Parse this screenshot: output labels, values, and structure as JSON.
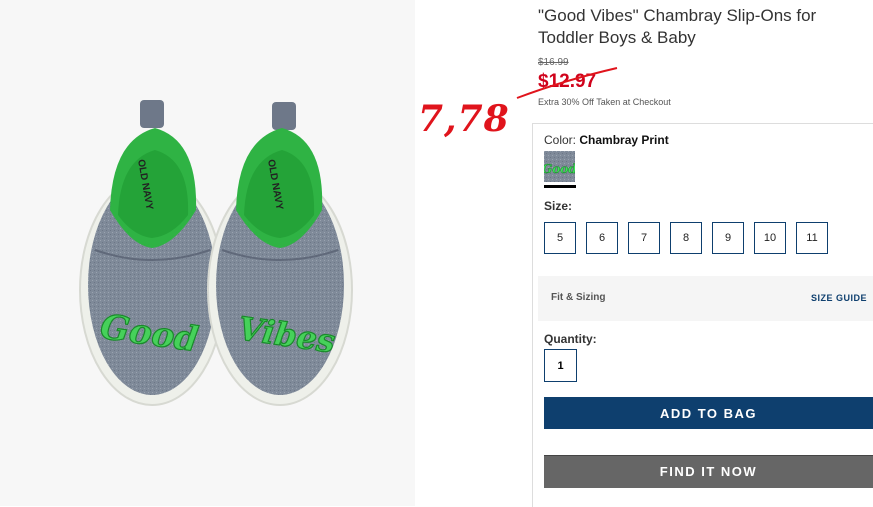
{
  "product": {
    "title": "\"Good Vibes\" Chambray Slip-Ons for Toddler Boys & Baby",
    "image_brand": "OLD NAVY",
    "shoe_text_left": "Good",
    "shoe_text_right": "Vibes",
    "accent_green": "#3ec24a",
    "chambray_blue": "#7f8a99"
  },
  "price": {
    "original": "$16.99",
    "sale": "$12.97",
    "promo": "Extra 30% Off Taken at Checkout",
    "sale_color": "#d0021b"
  },
  "annotation": {
    "handwritten_price": "7,78",
    "color": "#e0141c"
  },
  "color": {
    "label": "Color:",
    "value": "Chambray Print",
    "swatch_text": "Good"
  },
  "size": {
    "label": "Size:",
    "options": [
      "5",
      "6",
      "7",
      "8",
      "9",
      "10",
      "11"
    ]
  },
  "fit": {
    "label": "Fit & Sizing",
    "guide": "SIZE GUIDE"
  },
  "quantity": {
    "label": "Quantity:",
    "value": "1"
  },
  "buttons": {
    "add_to_bag": "ADD TO BAG",
    "find_it_now": "FIND IT NOW",
    "primary_color": "#0e3f6e"
  }
}
